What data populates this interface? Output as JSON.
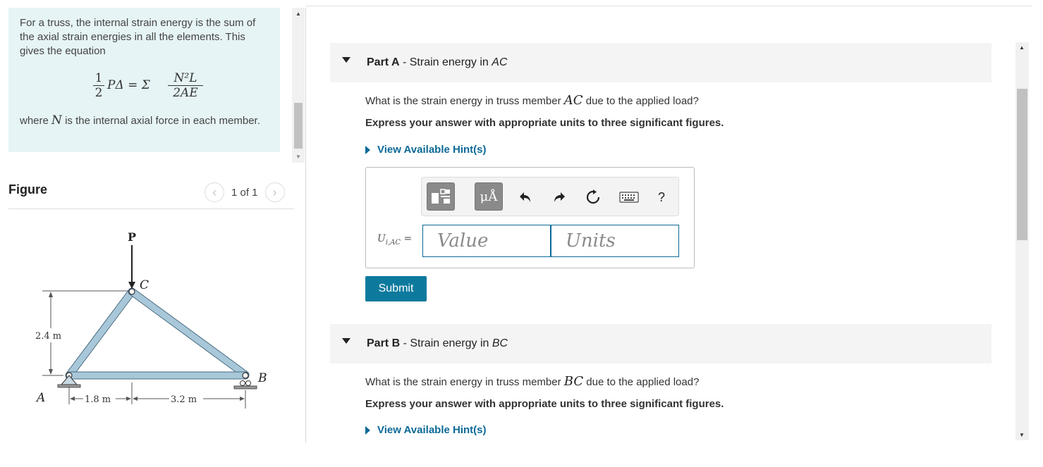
{
  "intro": {
    "text": "For a truss, the internal strain energy is the sum of the axial strain energies in all the elements. This gives the equation",
    "equation": {
      "half_num": "1",
      "half_den": "2",
      "lhs": "PΔ = Σ",
      "rhs_num": "N²L",
      "rhs_den": "2AE"
    },
    "after_prefix": "where ",
    "after_var": "N",
    "after_suffix": " is the internal axial force in each member."
  },
  "figure": {
    "title": "Figure",
    "pager": "1 of 1",
    "prev_icon": "chevron-left-icon",
    "next_icon": "chevron-right-icon",
    "labels": {
      "load": "P",
      "node_c": "C",
      "node_a": "A",
      "node_b": "B",
      "height": "2.4 m",
      "span_left": "1.8 m",
      "span_right": "3.2 m"
    },
    "member_color": "#a8c8da"
  },
  "partA": {
    "label": "Part A",
    "sep": " - ",
    "title_pre": "Strain energy in ",
    "title_var": "AC",
    "question_pre": "What is the strain energy in truss member ",
    "question_var": "AC",
    "question_post": " due to the applied load?",
    "instruction": "Express your answer with appropriate units to three significant figures.",
    "hint": "View Available Hint(s)",
    "answer_label": "Ui,AC =",
    "value_placeholder": "Value",
    "units_placeholder": "Units",
    "toolbar": {
      "units_button": "μÅ",
      "icons": [
        "templates-icon",
        "units-icon",
        "undo-icon",
        "redo-icon",
        "reset-icon",
        "keyboard-icon",
        "help-icon"
      ],
      "help": "?"
    },
    "submit": "Submit"
  },
  "partB": {
    "label": "Part B",
    "sep": " - ",
    "title_pre": "Strain energy in ",
    "title_var": "BC",
    "question_pre": "What is the strain energy in truss member ",
    "question_var": "BC",
    "question_post": " due to the applied load?",
    "instruction": "Express your answer with appropriate units to three significant figures.",
    "hint": "View Available Hint(s)"
  },
  "colors": {
    "accent": "#0d6a98",
    "submit": "#0d7a9d",
    "intro_bg": "#e6f4f6"
  }
}
